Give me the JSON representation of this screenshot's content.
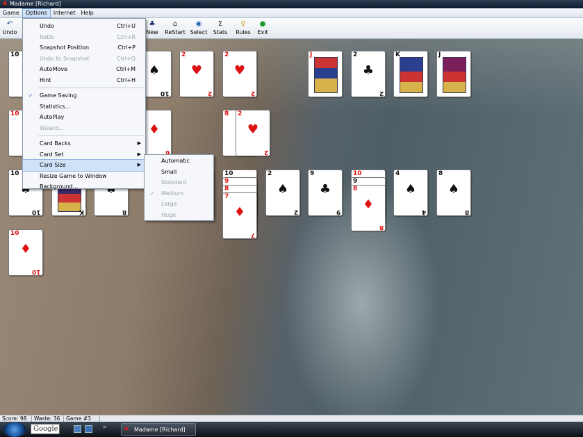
{
  "window": {
    "title": "Madame [Richard]"
  },
  "menubar": {
    "items": [
      "Game",
      "Options",
      "Internet",
      "Help"
    ]
  },
  "toolbar": {
    "buttons": [
      {
        "label": "Undo",
        "icon": "undo-icon",
        "glyph": "↶"
      },
      {
        "label": "New",
        "icon": "new-game-icon",
        "glyph": "♣"
      },
      {
        "label": "ReStart",
        "icon": "home-icon",
        "glyph": "⌂"
      },
      {
        "label": "Select",
        "icon": "globe-icon",
        "glyph": "◉"
      },
      {
        "label": "Stats",
        "icon": "sigma-icon",
        "glyph": "Σ"
      },
      {
        "label": "Rules",
        "icon": "lightbulb-icon",
        "glyph": "♀"
      },
      {
        "label": "Exit",
        "icon": "exit-icon",
        "glyph": "●"
      }
    ]
  },
  "options_menu": {
    "items": [
      {
        "label": "Undo",
        "shortcut": "Ctrl+U",
        "disabled": false
      },
      {
        "label": "ReDo",
        "shortcut": "Ctrl+R",
        "disabled": true
      },
      {
        "label": "Snapshot Position",
        "shortcut": "Ctrl+P",
        "disabled": false
      },
      {
        "label": "Undo to Snapshot",
        "shortcut": "Ctrl+Q",
        "disabled": true
      },
      {
        "label": "AutoMove",
        "shortcut": "Ctrl+M",
        "disabled": false
      },
      {
        "label": "Hint",
        "shortcut": "Ctrl+H",
        "disabled": false
      },
      {
        "label": "Game Saving",
        "checked": true
      },
      {
        "label": "Statistics..."
      },
      {
        "label": "AutoPlay"
      },
      {
        "label": "Wizard...",
        "disabled": true
      },
      {
        "label": "Card Backs",
        "submenu": true
      },
      {
        "label": "Card Set",
        "submenu": true
      },
      {
        "label": "Card Size",
        "submenu": true,
        "highlighted": true
      },
      {
        "label": "Resize Game to Window"
      },
      {
        "label": "Background..."
      }
    ]
  },
  "card_size_menu": {
    "items": [
      {
        "label": "Automatic",
        "disabled": false
      },
      {
        "label": "Small",
        "disabled": false
      },
      {
        "label": "Standard",
        "disabled": true
      },
      {
        "label": "Medium",
        "disabled": true,
        "checked": true
      },
      {
        "label": "Large",
        "disabled": true
      },
      {
        "label": "Huge",
        "disabled": true
      }
    ]
  },
  "cards": {
    "r1c1": {
      "rank": "10",
      "suit": "♠",
      "color": "black"
    },
    "r1c2": {
      "rank": "10",
      "suit": "♠",
      "color": "black"
    },
    "r1c3": {
      "rank": "2",
      "suit": "♥",
      "color": "red"
    },
    "r1c4": {
      "rank": "2",
      "suit": "♥",
      "color": "red"
    },
    "f1": {
      "rank": "J",
      "suit": "♥",
      "color": "red"
    },
    "f2": {
      "rank": "2",
      "suit": "♣",
      "color": "black"
    },
    "f3": {
      "rank": "K",
      "suit": "♠",
      "color": "black"
    },
    "f4": {
      "rank": "J",
      "suit": "♣",
      "color": "black"
    },
    "r2c1": {
      "rank": "10",
      "suit": "♦",
      "color": "red"
    },
    "r2c2": {
      "rank": "6",
      "suit": "♦",
      "color": "red"
    },
    "r2c3a": {
      "rank": "8",
      "suit": "♥",
      "color": "red"
    },
    "r2c3b": {
      "rank": "2",
      "suit": "♥",
      "color": "red"
    },
    "r3c1": {
      "rank": "10",
      "suit": "♠",
      "color": "black"
    },
    "r3c2": {
      "rank": "K",
      "suit": "♠",
      "color": "black"
    },
    "r3c3": {
      "rank": "8",
      "suit": "♠",
      "color": "black"
    },
    "r3c5": {
      "rank": "4",
      "suit": "♠",
      "color": "black"
    },
    "r3c6a": {
      "rank": "10",
      "suit": "♠",
      "color": "black"
    },
    "r3c6b": {
      "rank": "9",
      "suit": "♦",
      "color": "red"
    },
    "r3c6c": {
      "rank": "8",
      "suit": "♦",
      "color": "red"
    },
    "r3c6d": {
      "rank": "7",
      "suit": "♦",
      "color": "red"
    },
    "r3c7": {
      "rank": "2",
      "suit": "♠",
      "color": "black"
    },
    "r3c8": {
      "rank": "9",
      "suit": "♣",
      "color": "black"
    },
    "r3c9a": {
      "rank": "10",
      "suit": "♦",
      "color": "red"
    },
    "r3c9b": {
      "rank": "9",
      "suit": "♣",
      "color": "black"
    },
    "r3c9c": {
      "rank": "8",
      "suit": "♦",
      "color": "red"
    },
    "r3c10": {
      "rank": "4",
      "suit": "♠",
      "color": "black"
    },
    "r3c11": {
      "rank": "8",
      "suit": "♠",
      "color": "black"
    },
    "r4c1": {
      "rank": "10",
      "suit": "♦",
      "color": "red"
    }
  },
  "status": {
    "score": "Score: 98",
    "waste": "Waste: 36",
    "game": "Game #3"
  },
  "taskbar": {
    "search": "Google",
    "task_label": "Madame [Richard]"
  }
}
